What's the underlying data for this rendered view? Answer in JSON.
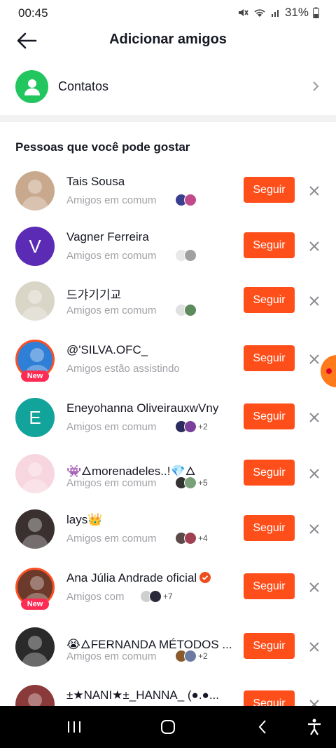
{
  "status_bar": {
    "time": "00:45",
    "battery": "31%"
  },
  "header": {
    "title": "Adicionar amigos"
  },
  "contacts": {
    "label": "Contatos"
  },
  "section": {
    "title": "Pessoas que você pode gostar"
  },
  "follow_label": "Seguir",
  "new_label": "New",
  "people": [
    {
      "name": "Tais Sousa",
      "subtitle": "Amigos em comum",
      "extra": "",
      "avatar_color": "#c9a98e"
    },
    {
      "name": "Vagner Ferreira",
      "subtitle": "Amigos em comum",
      "extra": "",
      "avatar_letter": "V",
      "avatar_color": "#5b2bb5"
    },
    {
      "name": "드갸기기교",
      "subtitle": "Amigos em comum",
      "extra": "",
      "avatar_color": "#d9d6c8"
    },
    {
      "name": "@'SILVA.OFC_",
      "subtitle": "Amigos estão assistindo",
      "extra": "",
      "avatar_color": "#2f7fd6"
    },
    {
      "name": "Eneyohanna OliveirauxwVny",
      "subtitle": "Amigos em comum",
      "extra": "+2",
      "avatar_letter": "E",
      "avatar_color": "#12a39a"
    },
    {
      "name": "👾🜂morenadeles..!💎🜂",
      "subtitle": "Amigos em comum",
      "extra": "+5",
      "avatar_color": "#f7d6df"
    },
    {
      "name": "lays👑",
      "subtitle": "Amigos em comum",
      "extra": "+4",
      "avatar_color": "#3a3030"
    },
    {
      "name": "Ana Júlia Andrade oficial",
      "subtitle": "Amigos com",
      "extra": "+7",
      "avatar_color": "#6b3a2a"
    },
    {
      "name": "😭🜂FERNANDA MÉTODOS ...",
      "subtitle": "Amigos em comum",
      "extra": "+2",
      "avatar_color": "#2a2a2a"
    },
    {
      "name": "±★NANI★±_HANNA_ (●.●...",
      "subtitle": "",
      "extra": "",
      "avatar_color": "#8a3a3a"
    }
  ],
  "icons": {
    "back": "arrow-left-icon",
    "contacts": "person-icon",
    "chevron": "chevron-right-icon",
    "dismiss": "close-icon",
    "verified": "verified-badge-icon"
  },
  "colors": {
    "accent": "#fe4f1b",
    "contacts_green": "#22c55e",
    "subtitle_gray": "#a1a2a7"
  }
}
